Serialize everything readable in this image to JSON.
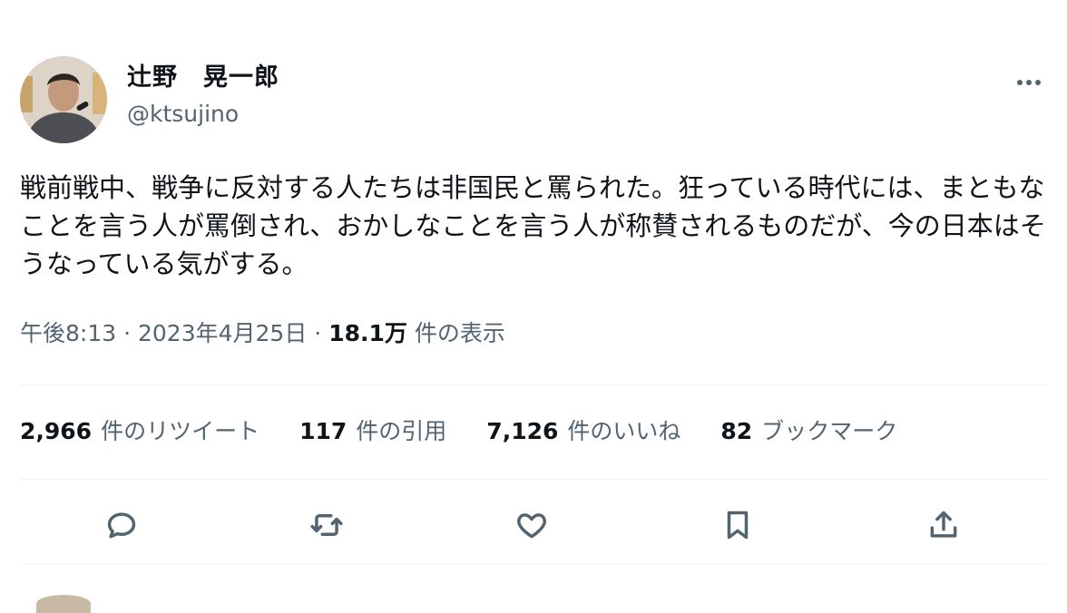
{
  "tweet": {
    "author": {
      "display_name": "辻野　晃一郎",
      "handle": "@ktsujino"
    },
    "text": "戦前戦中、戦争に反対する人たちは非国民と罵られた。狂っている時代には、まともなことを言う人が罵倒され、おかしなことを言う人が称賛されるものだが、今の日本はそうなっている気がする。",
    "time": "午後8:13",
    "separator": "·",
    "date": "2023年4月25日",
    "views_count": "18.1万",
    "views_label": "件の表示"
  },
  "stats": {
    "retweets": {
      "count": "2,966",
      "label": "件のリツイート"
    },
    "quotes": {
      "count": "117",
      "label": "件の引用"
    },
    "likes": {
      "count": "7,126",
      "label": "件のいいね"
    },
    "bookmarks": {
      "count": "82",
      "label": "ブックマーク"
    }
  },
  "icons": {
    "more": "more-icon",
    "reply": "reply-icon",
    "retweet": "retweet-icon",
    "like": "heart-icon",
    "bookmark": "bookmark-icon",
    "share": "share-icon"
  },
  "colors": {
    "text_primary": "#0f1419",
    "text_secondary": "#536471",
    "divider": "#eff3f4"
  }
}
